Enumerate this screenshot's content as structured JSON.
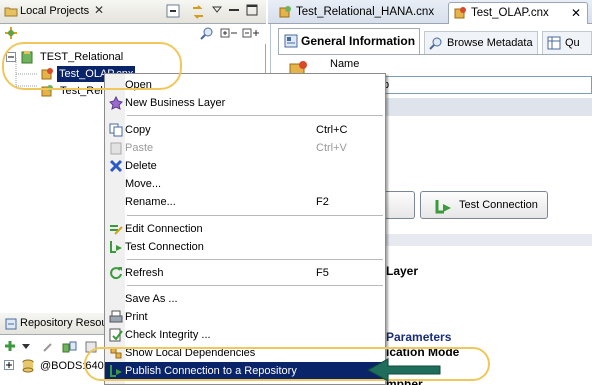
{
  "left_panel": {
    "title": "Local Projects",
    "close": "✕",
    "tree": {
      "root": "TEST_Relational",
      "child1": "Test_OLAP.cnx",
      "child2": "Test_Rel"
    }
  },
  "repo_panel": {
    "title": "Repository Resou",
    "item": "@BODS:640"
  },
  "editor": {
    "tabs": [
      "Test_Relational_HANA.cnx",
      "Test_OLAP.cnx"
    ],
    "close": "✕",
    "subtabs": [
      "General Information",
      "Browse Metadata",
      "Qu"
    ],
    "name_label": "Name",
    "name_value": "p",
    "test_connection_button": "Test Connection",
    "text_layer": "Layer",
    "text_parameters": "Parameters",
    "text_mode": "ication Mode",
    "text_cut": "mpher"
  },
  "context_menu": {
    "items": [
      {
        "label": "Open",
        "shortcut": ""
      },
      {
        "label": "New Business Layer",
        "shortcut": ""
      },
      {
        "label": "Copy",
        "shortcut": "Ctrl+C"
      },
      {
        "label": "Paste",
        "shortcut": "Ctrl+V"
      },
      {
        "label": "Delete",
        "shortcut": ""
      },
      {
        "label": "Move...",
        "shortcut": ""
      },
      {
        "label": "Rename...",
        "shortcut": "F2"
      },
      {
        "label": "Edit Connection",
        "shortcut": ""
      },
      {
        "label": "Test Connection",
        "shortcut": ""
      },
      {
        "label": "Refresh",
        "shortcut": "F5"
      },
      {
        "label": "Save As ...",
        "shortcut": ""
      },
      {
        "label": "Print",
        "shortcut": ""
      },
      {
        "label": "Check Integrity ...",
        "shortcut": ""
      },
      {
        "label": "Show Local Dependencies",
        "shortcut": ""
      },
      {
        "label": "Publish Connection to a Repository",
        "shortcut": ""
      }
    ]
  },
  "colors": {
    "selection": "#0a246a",
    "callout": "#f0c75a",
    "arrow": "#1f6e5c"
  }
}
